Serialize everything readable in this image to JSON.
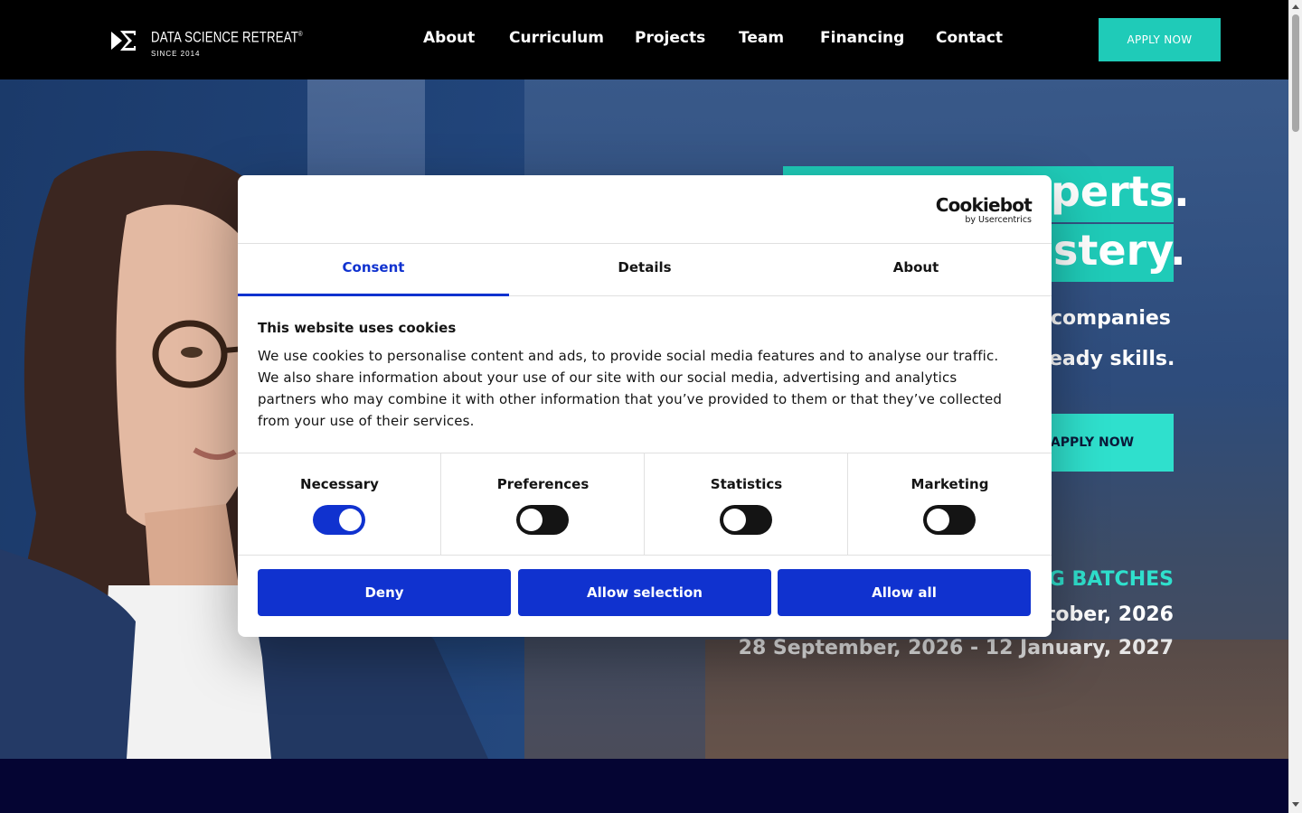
{
  "header": {
    "logo": {
      "name": "DATA SCIENCE RETREAT",
      "registered": "®",
      "since": "SINCE 2014"
    },
    "nav": [
      "About",
      "Curriculum",
      "Projects",
      "Team",
      "Financing",
      "Contact"
    ],
    "apply_label": "APPLY NOW"
  },
  "hero": {
    "headline_line1_fragment": "perts.",
    "headline_line2_fragment": "stery.",
    "sub_line1_fragment": "companies",
    "sub_line2_fragment": "eady skills.",
    "apply_label": "APPLY NOW",
    "batches_title_fragment": "G BATCHES",
    "batch_1_fragment": "tober, 2026",
    "batch_2": "28 September, 2026 - 12 January, 2027",
    "accent_color": "#1fcbb8"
  },
  "cookie_dialog": {
    "brand": {
      "name": "Cookiebot",
      "by": "by Usercentrics"
    },
    "tabs": [
      {
        "label": "Consent",
        "active": true
      },
      {
        "label": "Details",
        "active": false
      },
      {
        "label": "About",
        "active": false
      }
    ],
    "title": "This website uses cookies",
    "body": "We use cookies to personalise content and ads, to provide social media features and to analyse our traffic. We also share information about your use of our site with our social media, advertising and analytics partners who may combine it with other information that you’ve provided to them or that they’ve collected from your use of their services.",
    "categories": [
      {
        "label": "Necessary",
        "enabled": true
      },
      {
        "label": "Preferences",
        "enabled": false
      },
      {
        "label": "Statistics",
        "enabled": false
      },
      {
        "label": "Marketing",
        "enabled": false
      }
    ],
    "buttons": {
      "deny": "Deny",
      "allow_selection": "Allow selection",
      "allow_all": "Allow all"
    },
    "accent_color": "#1032cf"
  }
}
